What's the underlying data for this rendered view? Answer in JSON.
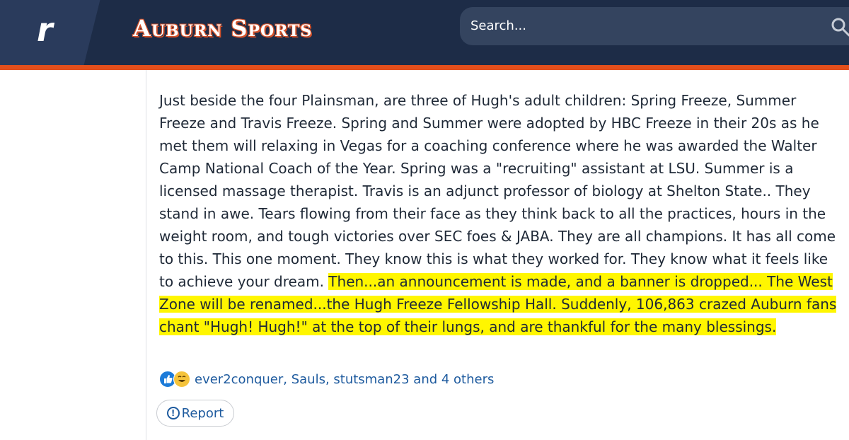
{
  "header": {
    "logo_letter": "r",
    "brand": "Auburn Sports",
    "search_placeholder": "Search..."
  },
  "post": {
    "body_plain": "Just beside the four Plainsman, are three of Hugh's adult children: Spring Freeze, Summer Freeze and Travis Freeze. Spring and Summer were adopted by HBC Freeze in their 20s as he met them will relaxing in Vegas for a coaching conference where he was awarded the Walter Camp National Coach of the Year. Spring was a \"recruiting\" assistant at LSU. Summer is a licensed massage therapist. Travis is an adjunct professor of biology at Shelton State.. They stand in awe. Tears flowing from their face as they think back to all the practices, hours in the weight room, and tough victories over SEC foes & JABA. They are all champions. It has all come to this. This one moment. They know this is what they worked for. They know what it feels like to achieve your dream. ",
    "body_highlighted": "Then...an announcement is made, and a banner is dropped... The West Zone will be renamed...the Hugh Freeze Fellowship Hall. Suddenly, 106,863 crazed Auburn fans chant \"Hugh! Hugh!\" at the top of their lungs, and are thankful for the many blessings.",
    "highlight_color": "#fff600"
  },
  "reactions": {
    "icons": [
      "like-icon",
      "laugh-icon"
    ],
    "names": "ever2conquer, Sauls, stutsman23 and 4 others"
  },
  "actions": {
    "report_label": "Report"
  },
  "colors": {
    "header_bg": "#1d2c47",
    "accent_stripe": "#e34f1c",
    "link": "#1d5a9e"
  }
}
